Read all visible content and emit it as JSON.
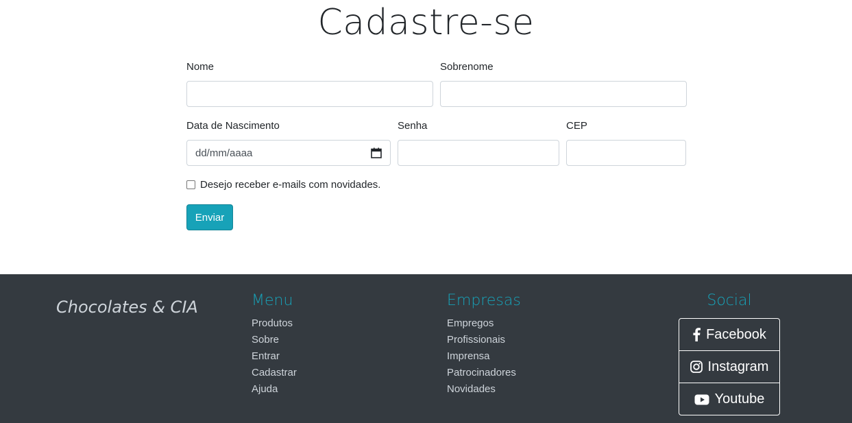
{
  "page": {
    "title": "Cadastre-se"
  },
  "form": {
    "first_name": {
      "label": "Nome",
      "value": "",
      "placeholder": ""
    },
    "last_name": {
      "label": "Sobrenome",
      "value": "",
      "placeholder": ""
    },
    "birth_date": {
      "label": "Data de Nascimento",
      "placeholder": "dd/mm/aaaa"
    },
    "password": {
      "label": "Senha",
      "value": "",
      "placeholder": ""
    },
    "cep": {
      "label": "CEP",
      "value": "",
      "placeholder": ""
    },
    "newsletter": {
      "label": "Desejo receber e-mails com novidades.",
      "checked": false
    },
    "submit_label": "Enviar"
  },
  "footer": {
    "brand": "Chocolates & CIA",
    "menu": {
      "title": "Menu",
      "items": [
        "Produtos",
        "Sobre",
        "Entrar",
        "Cadastrar",
        "Ajuda"
      ]
    },
    "companies": {
      "title": "Empresas",
      "items": [
        "Empregos",
        "Profissionais",
        "Imprensa",
        "Patrocinadores",
        "Novidades"
      ]
    },
    "social": {
      "title": "Social",
      "items": [
        {
          "label": "Facebook",
          "icon": "facebook-icon"
        },
        {
          "label": "Instagram",
          "icon": "instagram-icon"
        },
        {
          "label": "Youtube",
          "icon": "youtube-icon"
        }
      ]
    }
  },
  "colors": {
    "accent": "#17a2b8",
    "footer_bg": "#343a40",
    "footer_text": "#ced4da"
  }
}
